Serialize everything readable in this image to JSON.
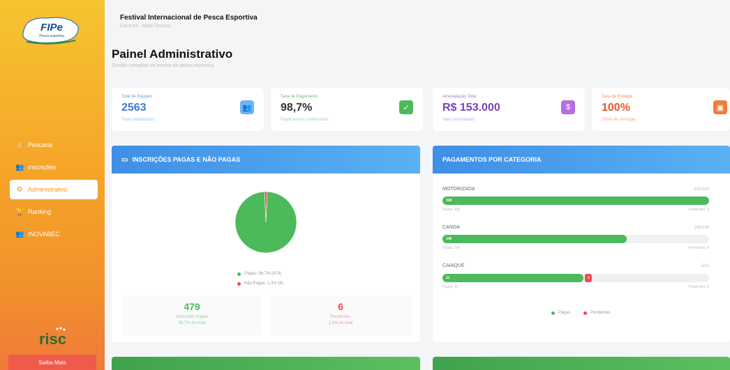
{
  "header": {
    "title": "Festival Internacional de Pesca Esportiva",
    "subtitle": "Cáceres · Mato Grosso"
  },
  "page": {
    "title": "Painel Administrativo",
    "subtitle": "Gestão completa do evento de pesca esportiva"
  },
  "logo": {
    "text": "FIPe",
    "tagline": "Pesca esportiva"
  },
  "sidebar": {
    "items": [
      {
        "label": "Pescaria",
        "icon": "home-icon",
        "active": false
      },
      {
        "label": "Inscrições",
        "icon": "users-icon",
        "active": false
      },
      {
        "label": "Administrativo",
        "icon": "gear-icon",
        "active": true
      },
      {
        "label": "Ranking",
        "icon": "trophy-icon",
        "active": false
      },
      {
        "label": "INOVABEC",
        "icon": "users-icon",
        "active": false
      }
    ],
    "brand": "risc",
    "logout_label": "Saiba Mais"
  },
  "stats": [
    {
      "label": "Total de Equipes",
      "value": "2563",
      "note": "Total cadastradas",
      "color": "#3a7bd5",
      "badge_color": "#6fb3f0",
      "icon": "users-icon"
    },
    {
      "label": "Taxa de Pagamento",
      "value": "98,7%",
      "note": "Pagamentos confirmados",
      "color": "#4cb95a",
      "badge_color": "#4cb95a",
      "icon": "check-circle-icon"
    },
    {
      "label": "Arrecadação Total",
      "value": "R$ 153.000",
      "note": "Valor arrecadado",
      "color": "#7b3fb8",
      "badge_color": "#b56ee0",
      "icon": "dollar-icon"
    },
    {
      "label": "Taxa de Entrega",
      "value": "100%",
      "note": "100% de entregas",
      "color": "#e8572a",
      "badge_color": "#f07c3c",
      "icon": "box-icon"
    }
  ],
  "pie_panel": {
    "title": "INSCRIÇÕES PAGAS E NÃO PAGAS",
    "legend": [
      {
        "label": "Pagas: 98,7% (479)",
        "color": "#4cb95a"
      },
      {
        "label": "Não Pagas: 1,3% (6)",
        "color": "#ee4a55"
      }
    ],
    "paid": {
      "count": "479",
      "label": "Inscrições Pagas",
      "pct": "98,7% do total"
    },
    "pending": {
      "count": "6",
      "label": "Pendentes",
      "pct": "1,3% do total"
    }
  },
  "cat_panel": {
    "title": "PAGAMENTOS POR CATEGORIA",
    "categories": [
      {
        "name": "MOTORIZADA",
        "total": "328/328",
        "paid": "328",
        "pending": "",
        "paid_fraction": 1.0,
        "sub_left": "Pagas: 328",
        "sub_right": "Pendentes: 0"
      },
      {
        "name": "CANOA",
        "total": "146/146",
        "paid": "146",
        "pending": "",
        "paid_fraction": 0.69,
        "sub_left": "Pagas: 146",
        "sub_right": "Pendentes: 0"
      },
      {
        "name": "CAIAQUE",
        "total": "5/11",
        "paid": "11",
        "pending": "6",
        "paid_fraction": 0.53,
        "sub_left": "Pagas: 11",
        "sub_right": "Pendentes: 6"
      }
    ],
    "legend": [
      {
        "label": "Pagas",
        "color": "#4cb95a"
      },
      {
        "label": "Pendentes",
        "color": "#ee4a55"
      }
    ]
  },
  "pie_data": {
    "paid_pct": 98.7,
    "pending_pct": 1.3,
    "paid_color": "#4cb95a",
    "pending_color": "#ee4a55"
  }
}
